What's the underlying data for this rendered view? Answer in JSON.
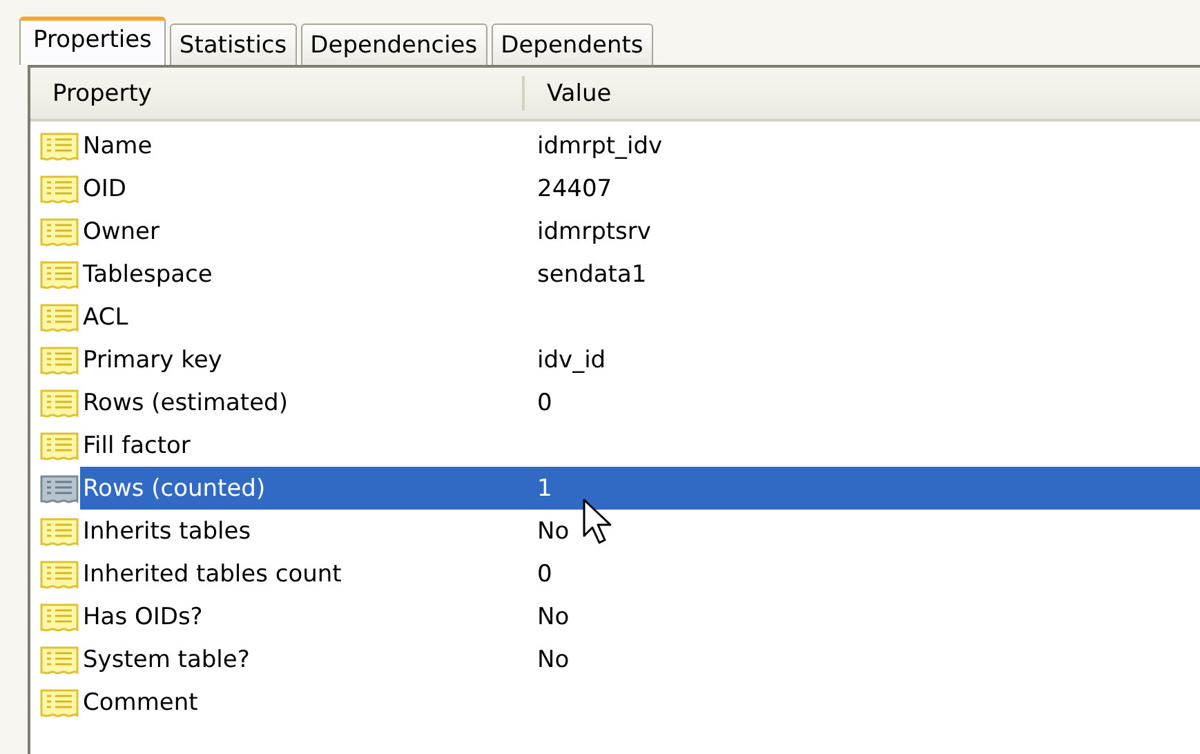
{
  "tabs": [
    {
      "label": "Properties",
      "selected": true
    },
    {
      "label": "Statistics",
      "selected": false
    },
    {
      "label": "Dependencies",
      "selected": false
    },
    {
      "label": "Dependents",
      "selected": false
    }
  ],
  "table": {
    "columns": [
      "Property",
      "Value"
    ],
    "rows": [
      {
        "property": "Name",
        "value": "idmrpt_idv",
        "selected": false
      },
      {
        "property": "OID",
        "value": "24407",
        "selected": false
      },
      {
        "property": "Owner",
        "value": "idmrptsrv",
        "selected": false
      },
      {
        "property": "Tablespace",
        "value": "sendata1",
        "selected": false
      },
      {
        "property": "ACL",
        "value": "",
        "selected": false
      },
      {
        "property": "Primary key",
        "value": "idv_id",
        "selected": false
      },
      {
        "property": "Rows (estimated)",
        "value": "0",
        "selected": false
      },
      {
        "property": "Fill factor",
        "value": "",
        "selected": false
      },
      {
        "property": "Rows (counted)",
        "value": "1",
        "selected": true
      },
      {
        "property": "Inherits tables",
        "value": "No",
        "selected": false
      },
      {
        "property": "Inherited tables count",
        "value": "0",
        "selected": false
      },
      {
        "property": "Has OIDs?",
        "value": "No",
        "selected": false
      },
      {
        "property": "System table?",
        "value": "No",
        "selected": false
      },
      {
        "property": "Comment",
        "value": "",
        "selected": false
      }
    ]
  }
}
